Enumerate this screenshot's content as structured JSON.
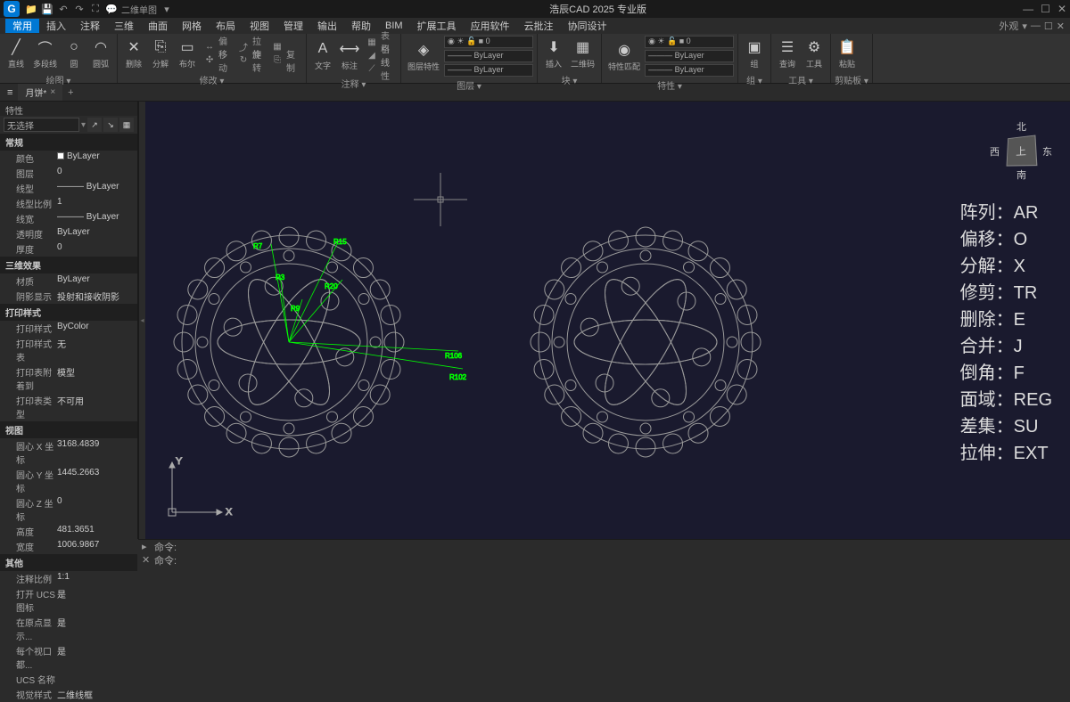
{
  "app": {
    "title": "浩辰CAD 2025 专业版",
    "logo": "G"
  },
  "qat": [
    "folder",
    "save",
    "undo",
    "redo",
    "chat",
    "model"
  ],
  "qat_label": "二维单图",
  "menu": {
    "items": [
      "常用",
      "插入",
      "注释",
      "三维",
      "曲面",
      "网格",
      "布局",
      "视图",
      "管理",
      "输出",
      "帮助",
      "BIM",
      "扩展工具",
      "应用软件",
      "云批注",
      "协同设计"
    ],
    "right": "外观"
  },
  "ribbon": {
    "groups": [
      {
        "label": "绘图",
        "tools": [
          {
            "i": "╱",
            "t": "直线"
          },
          {
            "i": "⌒",
            "t": "多段线"
          },
          {
            "i": "○",
            "t": "圆"
          },
          {
            "i": "◠",
            "t": "圆弧"
          }
        ]
      },
      {
        "label": "修改",
        "tools": [
          {
            "i": "✕",
            "t": "删除"
          },
          {
            "i": "⎘",
            "t": "分解"
          },
          {
            "i": "▭",
            "t": "布尔"
          }
        ],
        "sm": [
          [
            "↔",
            "偏移",
            "⤴",
            "拉伸",
            "▦"
          ],
          [
            "✣",
            "移动",
            "↻",
            "旋转",
            "⎘",
            "复制"
          ]
        ]
      },
      {
        "label": "注释",
        "tools": [
          {
            "i": "A",
            "t": "文字"
          },
          {
            "i": "⟷",
            "t": "标注"
          }
        ],
        "sm": [
          [
            "▦",
            "表格"
          ],
          [
            "◢",
            "引线"
          ],
          [
            "⟋",
            "线性"
          ]
        ]
      },
      {
        "label": "图层",
        "tools": [
          {
            "i": "◈",
            "t": "图层特性"
          }
        ],
        "layers": true
      },
      {
        "label": "块",
        "tools": [
          {
            "i": "⬇",
            "t": "插入"
          },
          {
            "i": "▦",
            "t": "二维码"
          }
        ]
      },
      {
        "label": "特性",
        "tools": [
          {
            "i": "◉",
            "t": "特性匹配"
          }
        ],
        "layers": true
      },
      {
        "label": "组",
        "tools": [
          {
            "i": "▣",
            "t": "组"
          }
        ]
      },
      {
        "label": "工具",
        "tools": [
          {
            "i": "☰",
            "t": "查询"
          },
          {
            "i": "⚙",
            "t": "工具"
          }
        ]
      },
      {
        "label": "剪贴板",
        "tools": [
          {
            "i": "📋",
            "t": "粘贴"
          }
        ]
      }
    ]
  },
  "doctab": {
    "name": "月饼*"
  },
  "props": {
    "title": "特性",
    "selection": "无选择",
    "sections": [
      {
        "h": "常规",
        "rows": [
          {
            "k": "颜色",
            "v": "ByLayer",
            "swatch": true
          },
          {
            "k": "图层",
            "v": "0"
          },
          {
            "k": "线型",
            "v": "——— ByLayer"
          },
          {
            "k": "线型比例",
            "v": "1"
          },
          {
            "k": "线宽",
            "v": "——— ByLayer"
          },
          {
            "k": "透明度",
            "v": "ByLayer"
          },
          {
            "k": "厚度",
            "v": "0"
          }
        ]
      },
      {
        "h": "三维效果",
        "rows": [
          {
            "k": "材质",
            "v": "ByLayer"
          },
          {
            "k": "阴影显示",
            "v": "投射和接收阴影"
          }
        ]
      },
      {
        "h": "打印样式",
        "rows": [
          {
            "k": "打印样式",
            "v": "ByColor"
          },
          {
            "k": "打印样式表",
            "v": "无"
          },
          {
            "k": "打印表附着到",
            "v": "模型"
          },
          {
            "k": "打印表类型",
            "v": "不可用"
          }
        ]
      },
      {
        "h": "视图",
        "rows": [
          {
            "k": "圆心 X 坐标",
            "v": "3168.4839"
          },
          {
            "k": "圆心 Y 坐标",
            "v": "1445.2663"
          },
          {
            "k": "圆心 Z 坐标",
            "v": "0"
          },
          {
            "k": "高度",
            "v": "481.3651"
          },
          {
            "k": "宽度",
            "v": "1006.9867"
          }
        ]
      },
      {
        "h": "其他",
        "rows": [
          {
            "k": "注释比例",
            "v": "1:1"
          },
          {
            "k": "打开 UCS 图标",
            "v": "是"
          },
          {
            "k": "在原点显示...",
            "v": "是"
          },
          {
            "k": "每个视口都...",
            "v": "是"
          },
          {
            "k": "UCS 名称",
            "v": ""
          },
          {
            "k": "视觉样式",
            "v": "二维线框"
          }
        ]
      }
    ]
  },
  "viewcube": {
    "face": "上",
    "n": "北",
    "s": "南",
    "e": "东",
    "w": "西"
  },
  "shortcuts": [
    "阵列：AR",
    "偏移：O",
    "分解：X",
    "修剪：TR",
    "删除：E",
    "合并：J",
    "倒角：F",
    "面域：REG",
    "差集：SU",
    "拉伸：EXT"
  ],
  "ucs": {
    "x": "X",
    "y": "Y"
  },
  "cmd": {
    "prompt": "命令:"
  }
}
